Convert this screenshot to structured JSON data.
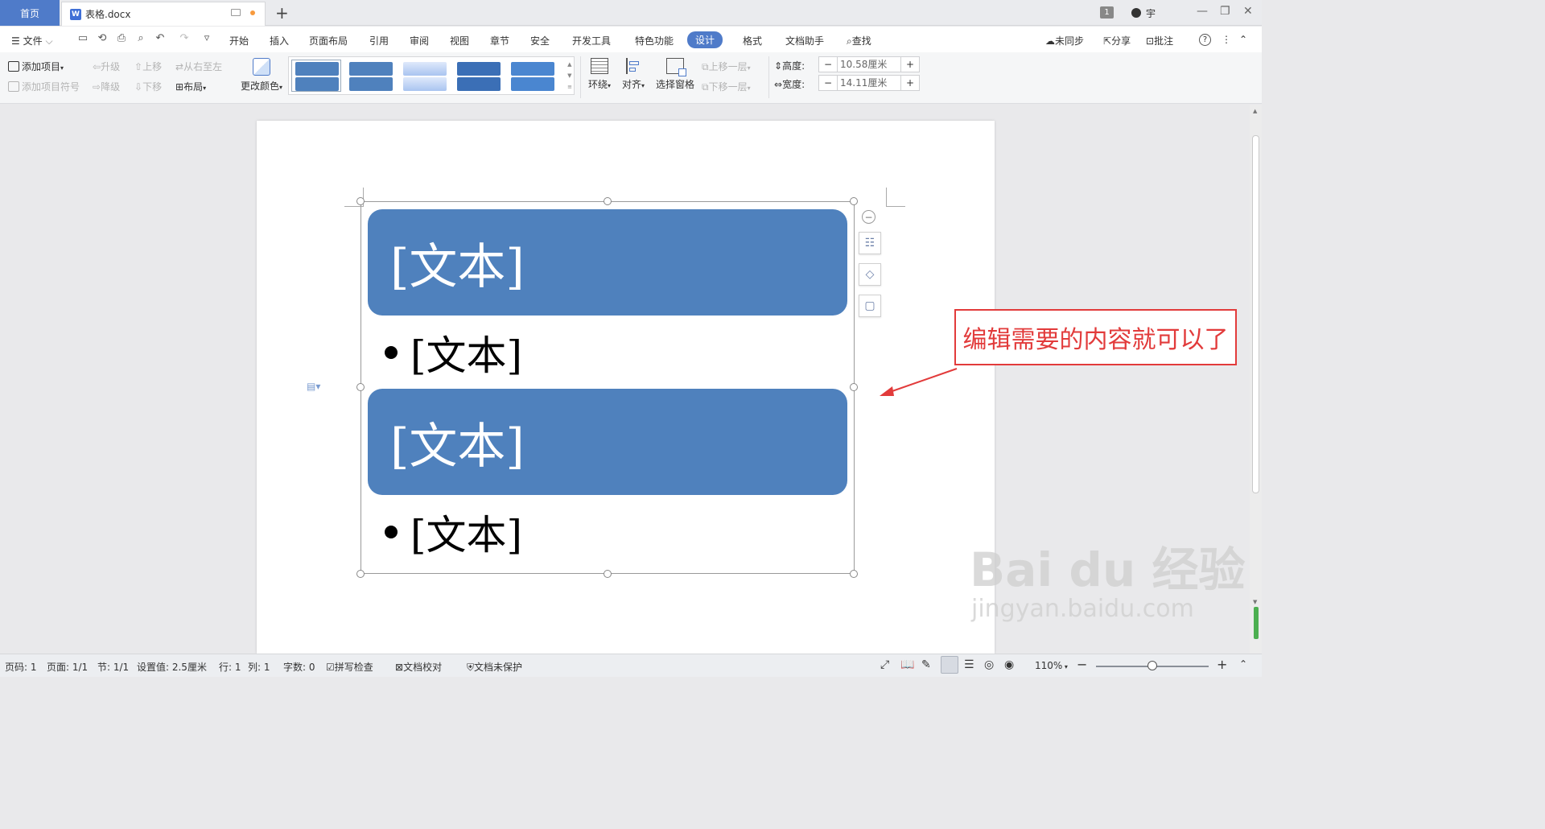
{
  "titlebar": {
    "home_tab": "首页",
    "doc_tab": "表格.docx",
    "doc_logo": "W",
    "new_tab": "+",
    "badge": "1",
    "user": "宇",
    "minimize": "—",
    "maximize": "❐",
    "close": "✕"
  },
  "menubar": {
    "file": "文件",
    "items": [
      "开始",
      "插入",
      "页面布局",
      "引用",
      "审阅",
      "视图",
      "章节",
      "安全",
      "开发工具",
      "特色功能",
      "设计",
      "格式",
      "文档助手"
    ],
    "active": "设计",
    "search": "查找",
    "sync": "未同步",
    "share": "分享",
    "comment": "批注",
    "help": "?",
    "more": "⋮",
    "collapse": "⌃"
  },
  "ribbon": {
    "add_item": "添加项目",
    "add_bullet": "添加项目符号",
    "promote": "升级",
    "demote": "降级",
    "move_up": "上移",
    "move_down": "下移",
    "rtl": "从右至左",
    "layout": "布局",
    "change_color": "更改颜色",
    "wrap": "环绕",
    "align": "对齐",
    "selection_pane": "选择窗格",
    "bring_forward": "上移一层",
    "send_backward": "下移一层",
    "height_label": "高度:",
    "height_value": "10.58厘米",
    "width_label": "宽度:",
    "width_value": "14.11厘米",
    "minus": "−",
    "plus": "+",
    "style_colors": [
      "#4f81bd",
      "#4f81bd",
      "#a9c4f0",
      "#3b6fb6",
      "#4a86d0"
    ]
  },
  "document": {
    "block1": "[文本]",
    "bullet1": "[文本]",
    "block2": "[文本]",
    "bullet2": "[文本]",
    "block_color": "#4f81bd"
  },
  "callout": {
    "text": "编辑需要的内容就可以了",
    "color": "#e23b3b"
  },
  "watermark": {
    "brand": "Bai du",
    "cn": "经验",
    "url": "jingyan.baidu.com"
  },
  "statusbar": {
    "page_no": "页码: 1",
    "pages": "页面: 1/1",
    "section": "节: 1/1",
    "setting": "设置值: 2.5厘米",
    "row": "行: 1",
    "col": "列: 1",
    "words": "字数: 0",
    "spell": "拼写检查",
    "proof": "文档校对",
    "protect": "文档未保护",
    "zoom": "110%",
    "zoom_level": 0.45
  }
}
